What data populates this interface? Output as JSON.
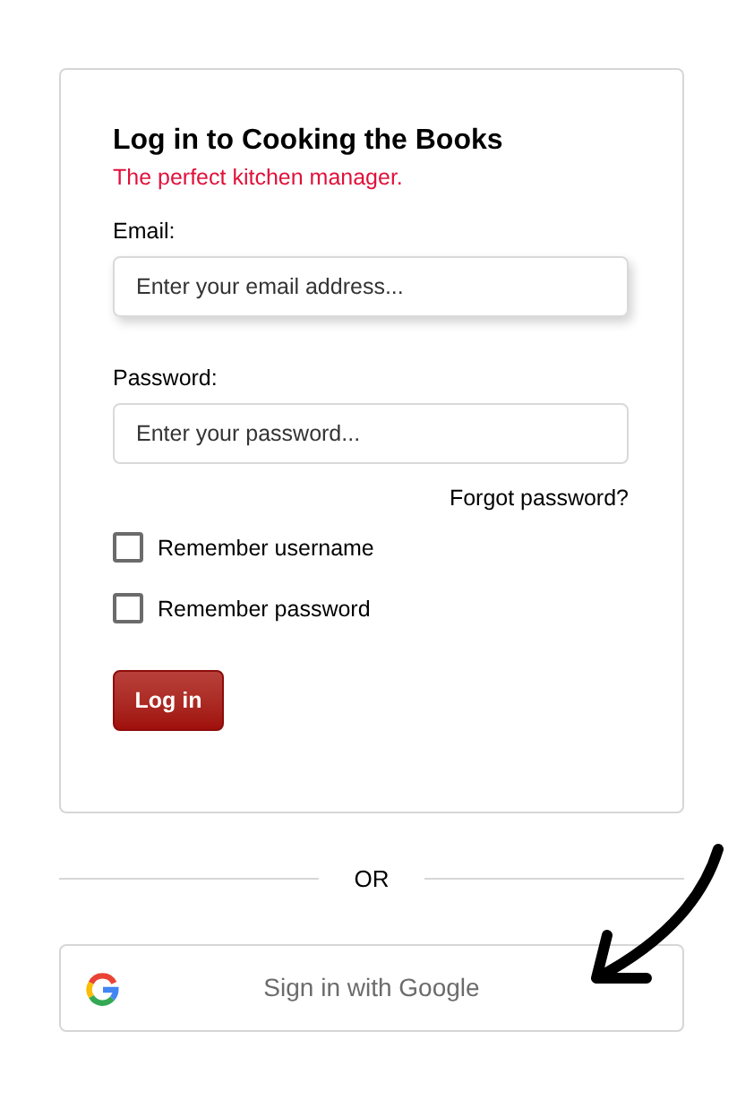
{
  "login_card": {
    "title": "Log in to Cooking the Books",
    "subtitle": "The perfect kitchen manager.",
    "fields": [
      {
        "label": "Email:",
        "placeholder": "Enter your email address...",
        "focused": true
      },
      {
        "label": "Password:",
        "placeholder": "Enter your password...",
        "focused": false
      }
    ],
    "forgot_link": "Forgot password?",
    "checkboxes": [
      {
        "label": "Remember username",
        "checked": false
      },
      {
        "label": "Remember password",
        "checked": false
      }
    ],
    "submit_button": "Log in"
  },
  "divider_text": "OR",
  "google_button": "Sign in with Google"
}
